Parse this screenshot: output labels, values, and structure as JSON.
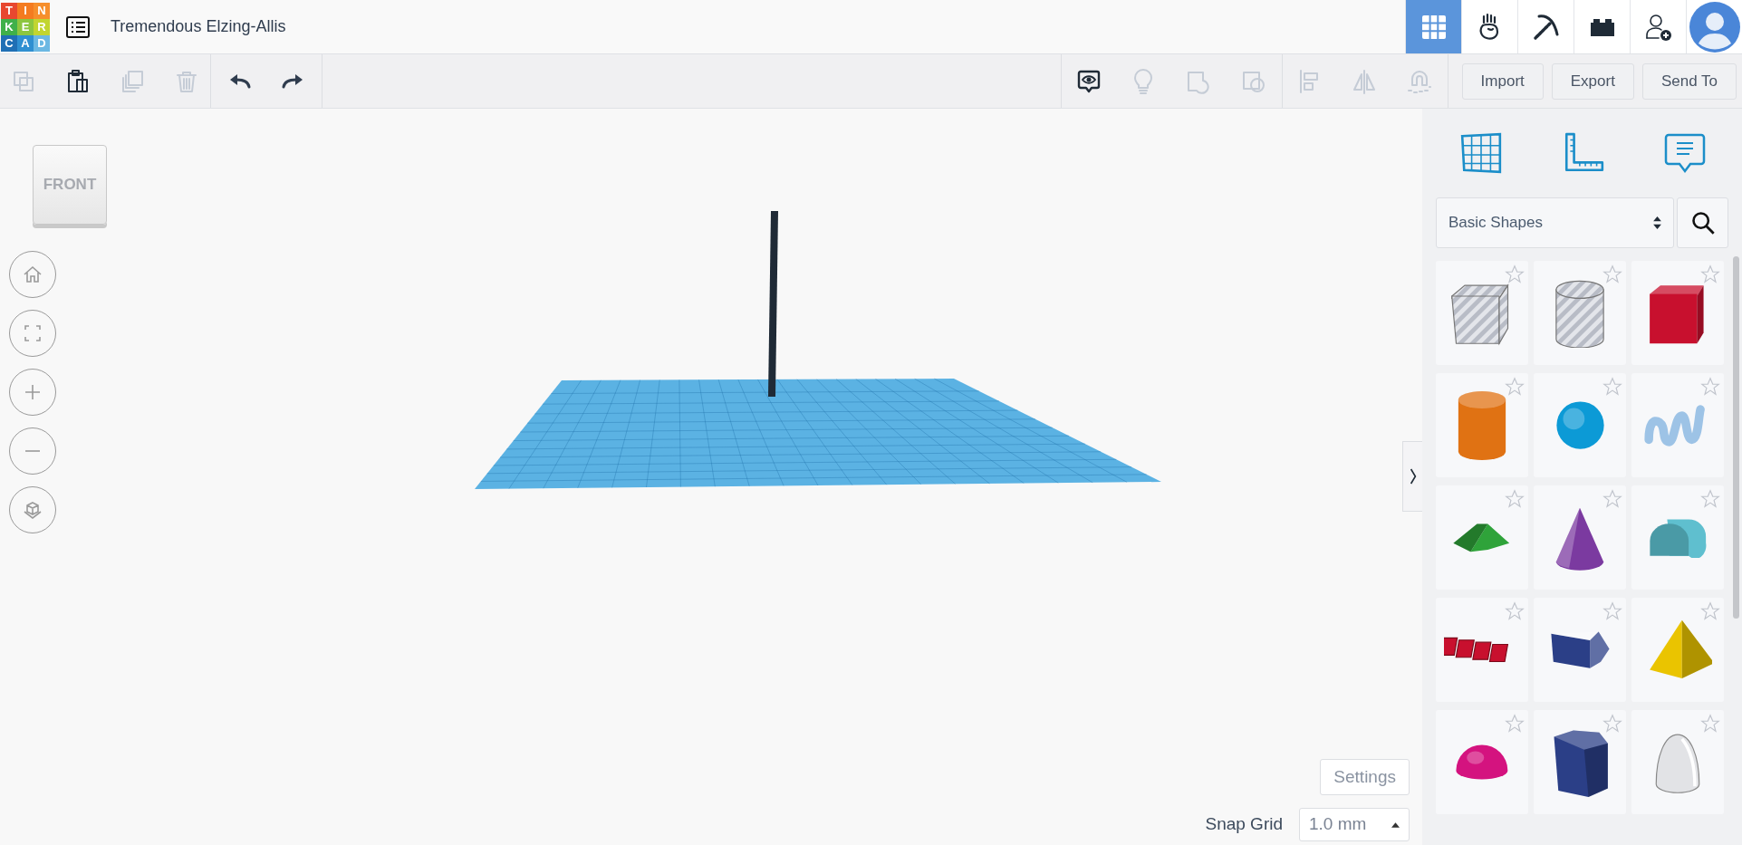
{
  "header": {
    "logo": [
      {
        "letter": "T",
        "color": "#e8472f"
      },
      {
        "letter": "I",
        "color": "#f47b20"
      },
      {
        "letter": "N",
        "color": "#f68f2c"
      },
      {
        "letter": "K",
        "color": "#3fb04a"
      },
      {
        "letter": "E",
        "color": "#8cc63f"
      },
      {
        "letter": "R",
        "color": "#c2d530"
      },
      {
        "letter": "C",
        "color": "#1f6fb5"
      },
      {
        "letter": "A",
        "color": "#2f8fd1"
      },
      {
        "letter": "D",
        "color": "#6cb8e3"
      }
    ],
    "title": "Tremendous Elzing-Allis",
    "nav": [
      {
        "kind": "grid",
        "selected": true
      },
      {
        "kind": "hand",
        "selected": false
      },
      {
        "kind": "pickaxe",
        "selected": false
      },
      {
        "kind": "brick",
        "selected": false
      },
      {
        "kind": "add-user",
        "selected": false
      }
    ]
  },
  "toolbar": {
    "edit_tools": [
      {
        "kind": "copy",
        "disabled": true
      },
      {
        "kind": "paste",
        "disabled": false
      },
      {
        "kind": "duplicate",
        "disabled": true
      },
      {
        "kind": "delete",
        "disabled": true
      }
    ],
    "history": [
      {
        "kind": "undo",
        "disabled": false
      },
      {
        "kind": "redo",
        "disabled": false
      }
    ],
    "view_tools": [
      {
        "kind": "notes",
        "disabled": false
      },
      {
        "kind": "bulb",
        "disabled": true
      },
      {
        "kind": "hole",
        "disabled": true
      },
      {
        "kind": "group",
        "disabled": true
      },
      {
        "kind": "align",
        "disabled": true
      },
      {
        "kind": "mirror",
        "disabled": true
      },
      {
        "kind": "magnet",
        "disabled": true
      }
    ],
    "actions": [
      "Import",
      "Export",
      "Send To"
    ]
  },
  "view_cube": {
    "label": "FRONT"
  },
  "library": {
    "category": "Basic Shapes",
    "shapes": [
      {
        "kind": "box-hole",
        "color": "#b8bcc6",
        "starred": false
      },
      {
        "kind": "cylinder-hole",
        "color": "#b8bcc6",
        "starred": false
      },
      {
        "kind": "box",
        "color": "#c8102e",
        "starred": false
      },
      {
        "kind": "cylinder",
        "color": "#e07213",
        "starred": false
      },
      {
        "kind": "sphere",
        "color": "#0c9ad6",
        "starred": false
      },
      {
        "kind": "scribble",
        "color": "#9dc3e6",
        "starred": false
      },
      {
        "kind": "roof",
        "color": "#2fa33a",
        "starred": false
      },
      {
        "kind": "cone",
        "color": "#7b3aa0",
        "starred": false
      },
      {
        "kind": "round-roof",
        "color": "#5fbfcf",
        "starred": false
      },
      {
        "kind": "text",
        "color": "#c8102e",
        "starred": false
      },
      {
        "kind": "prism",
        "color": "#2b3f87",
        "starred": false
      },
      {
        "kind": "pyramid",
        "color": "#eac400",
        "starred": false
      },
      {
        "kind": "half-sphere",
        "color": "#d4137f",
        "starred": false
      },
      {
        "kind": "polygon",
        "color": "#2b3f87",
        "starred": false
      },
      {
        "kind": "paraboloid",
        "color": "#e2e3e6",
        "starred": false
      }
    ]
  },
  "settings": {
    "button": "Settings",
    "snap_label": "Snap Grid",
    "snap_value": "1.0 mm"
  }
}
